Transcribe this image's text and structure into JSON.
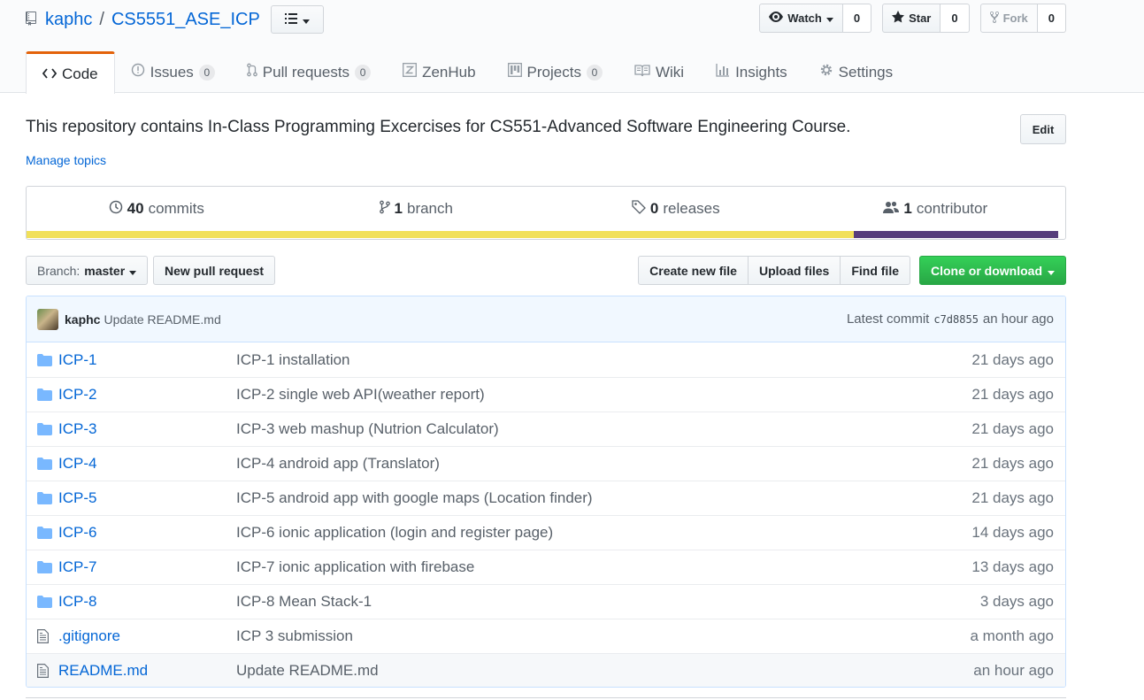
{
  "repo": {
    "owner": "kaphc",
    "separator": "/",
    "name": "CS5551_ASE_ICP"
  },
  "actions": {
    "watch_label": "Watch",
    "watch_count": "0",
    "star_label": "Star",
    "star_count": "0",
    "fork_label": "Fork",
    "fork_count": "0"
  },
  "nav": {
    "code": "Code",
    "issues": "Issues",
    "issues_count": "0",
    "pulls": "Pull requests",
    "pulls_count": "0",
    "zenhub": "ZenHub",
    "projects": "Projects",
    "projects_count": "0",
    "wiki": "Wiki",
    "insights": "Insights",
    "settings": "Settings"
  },
  "description": {
    "text": "This repository contains In-Class Programming Excercises for CS551-Advanced Software Engineering Course.",
    "edit_label": "Edit",
    "manage_topics": "Manage topics"
  },
  "summary": {
    "commits_num": "40",
    "commits_label": "commits",
    "branch_num": "1",
    "branch_label": "branch",
    "releases_num": "0",
    "releases_label": "releases",
    "contributors_num": "1",
    "contributors_label": "contributor"
  },
  "language_bar": {
    "colors": [
      "#f1e05a",
      "#563d7c"
    ],
    "fractions": [
      0.802,
      0.198
    ]
  },
  "file_nav": {
    "branch_prefix": "Branch:",
    "branch_name": "master",
    "new_pr": "New pull request",
    "create_file": "Create new file",
    "upload_files": "Upload files",
    "find_file": "Find file",
    "clone": "Clone or download"
  },
  "latest_commit": {
    "author": "kaphc",
    "message": "Update README.md",
    "prefix": "Latest commit",
    "sha": "c7d8855",
    "age": "an hour ago"
  },
  "files": [
    {
      "type": "dir",
      "name": "ICP-1",
      "message": "ICP-1 installation",
      "age": "21 days ago"
    },
    {
      "type": "dir",
      "name": "ICP-2",
      "message": "ICP-2 single web API(weather report)",
      "age": "21 days ago"
    },
    {
      "type": "dir",
      "name": "ICP-3",
      "message": "ICP-3 web mashup (Nutrion Calculator)",
      "age": "21 days ago"
    },
    {
      "type": "dir",
      "name": "ICP-4",
      "message": "ICP-4 android app (Translator)",
      "age": "21 days ago"
    },
    {
      "type": "dir",
      "name": "ICP-5",
      "message": "ICP-5 android app with google maps (Location finder)",
      "age": "21 days ago"
    },
    {
      "type": "dir",
      "name": "ICP-6",
      "message": "ICP-6 ionic application (login and register page)",
      "age": "14 days ago"
    },
    {
      "type": "dir",
      "name": "ICP-7",
      "message": "ICP-7 ionic application with firebase",
      "age": "13 days ago"
    },
    {
      "type": "dir",
      "name": "ICP-8",
      "message": "ICP-8 Mean Stack-1",
      "age": "3 days ago"
    },
    {
      "type": "file",
      "name": ".gitignore",
      "message": "ICP 3 submission",
      "age": "a month ago"
    },
    {
      "type": "file",
      "name": "README.md",
      "message": "Update README.md",
      "age": "an hour ago"
    }
  ]
}
